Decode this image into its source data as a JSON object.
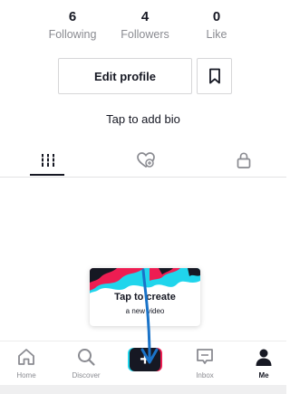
{
  "stats": {
    "following": {
      "value": "6",
      "label": "Following"
    },
    "followers": {
      "value": "4",
      "label": "Followers"
    },
    "likes": {
      "value": "0",
      "label": "Like"
    }
  },
  "profile": {
    "edit_label": "Edit profile",
    "bio_prompt": "Tap to add bio"
  },
  "tabs": [
    {
      "icon": "grid-icon",
      "active": true
    },
    {
      "icon": "liked-heart-icon",
      "active": false
    },
    {
      "icon": "lock-icon",
      "active": false
    }
  ],
  "create_card": {
    "title": "Tap to create",
    "subtitle": "a new video"
  },
  "nav": {
    "home": "Home",
    "discover": "Discover",
    "create_symbol": "+",
    "inbox": "Inbox",
    "me": "Me"
  },
  "colors": {
    "accent_red": "#ee1d52",
    "accent_cyan": "#20d5ec",
    "annotation_arrow": "#1a73c8",
    "text_dark": "#161823",
    "text_muted": "#8a8b91"
  }
}
